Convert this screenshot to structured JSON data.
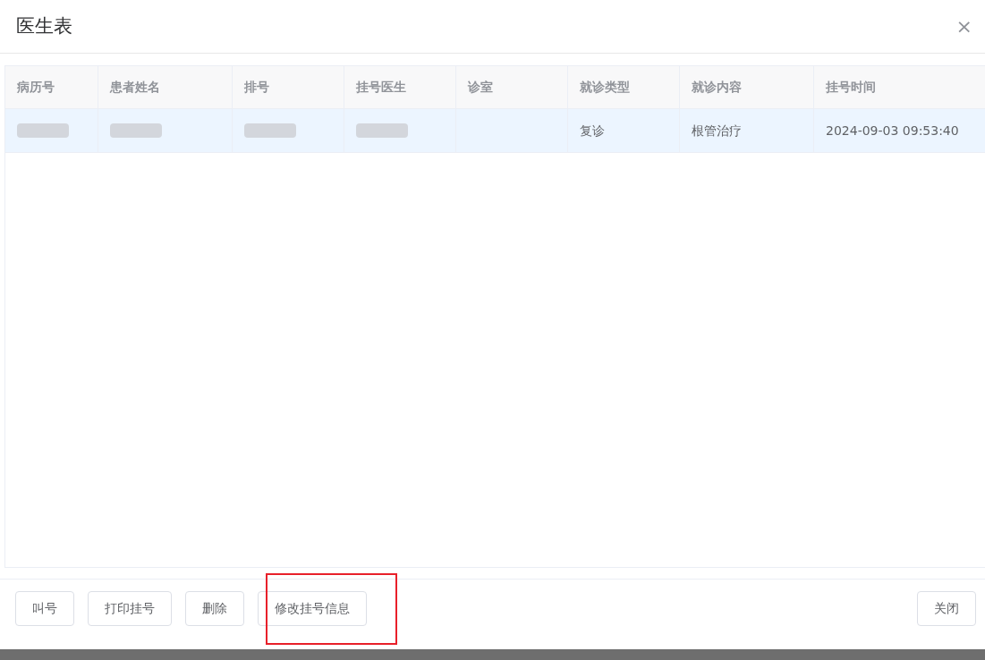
{
  "dialog": {
    "title": "医生表",
    "close": "×"
  },
  "table": {
    "columns": [
      "病历号",
      "患者姓名",
      "排号",
      "挂号医生",
      "诊室",
      "就诊类型",
      "就诊内容",
      "挂号时间"
    ],
    "rows": [
      {
        "selected": true,
        "cells": [
          {
            "kind": "redacted"
          },
          {
            "kind": "redacted"
          },
          {
            "kind": "redacted"
          },
          {
            "kind": "redacted"
          },
          {
            "kind": "empty"
          },
          {
            "kind": "text",
            "text": "复诊"
          },
          {
            "kind": "text",
            "text": "根管治疗"
          },
          {
            "kind": "text",
            "text": "2024-09-03 09:53:40"
          }
        ]
      }
    ]
  },
  "buttons": [
    {
      "label": "叫号",
      "highlighted": false
    },
    {
      "label": "打印挂号",
      "highlighted": false
    },
    {
      "label": "删除",
      "highlighted": false
    },
    {
      "label": "修改挂号信息",
      "highlighted": true
    }
  ],
  "close_button": "关闭"
}
